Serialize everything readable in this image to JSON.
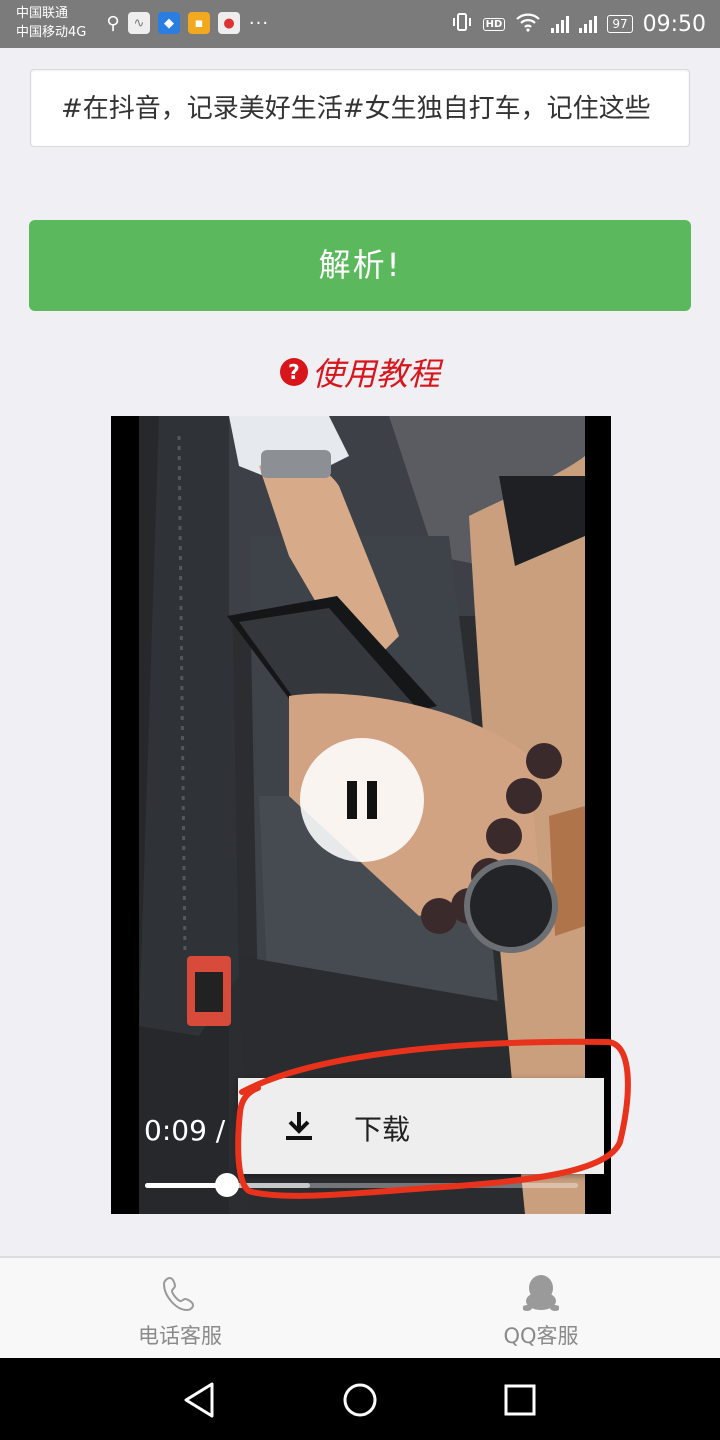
{
  "status_bar": {
    "carrier_1": "中国联通",
    "carrier_2": "中国移动4G",
    "network_1": "4G",
    "network_2": "4G",
    "hd_label": "HD",
    "battery": "97",
    "time": "09:50",
    "more_indicator": "···"
  },
  "input": {
    "value": "#在抖音，记录美好生活#女生独自打车，记住这些"
  },
  "parse_button": {
    "label": "解析!"
  },
  "tutorial": {
    "help_symbol": "?",
    "label": "使用教程"
  },
  "video": {
    "current_time": "0:09 / (",
    "progress_played": 0.19,
    "progress_buffered": 0.38,
    "state": "playing",
    "context_menu": {
      "download_label": "下载"
    }
  },
  "bottom_bar": {
    "phone_service": "电话客服",
    "qq_service": "QQ客服"
  },
  "colors": {
    "accent_green": "#5cb85c",
    "tutorial_red": "#d9151c",
    "annotation_red": "#e8321c"
  },
  "icons": [
    "usb-icon",
    "pulse-icon",
    "shield-icon",
    "app-icon",
    "map-pin-icon",
    "vibrate-icon",
    "wifi-icon",
    "signal-icon",
    "battery-icon",
    "help-icon",
    "pause-icon",
    "download-icon",
    "phone-icon",
    "qq-penguin-icon",
    "back-icon",
    "home-icon",
    "recent-apps-icon"
  ]
}
